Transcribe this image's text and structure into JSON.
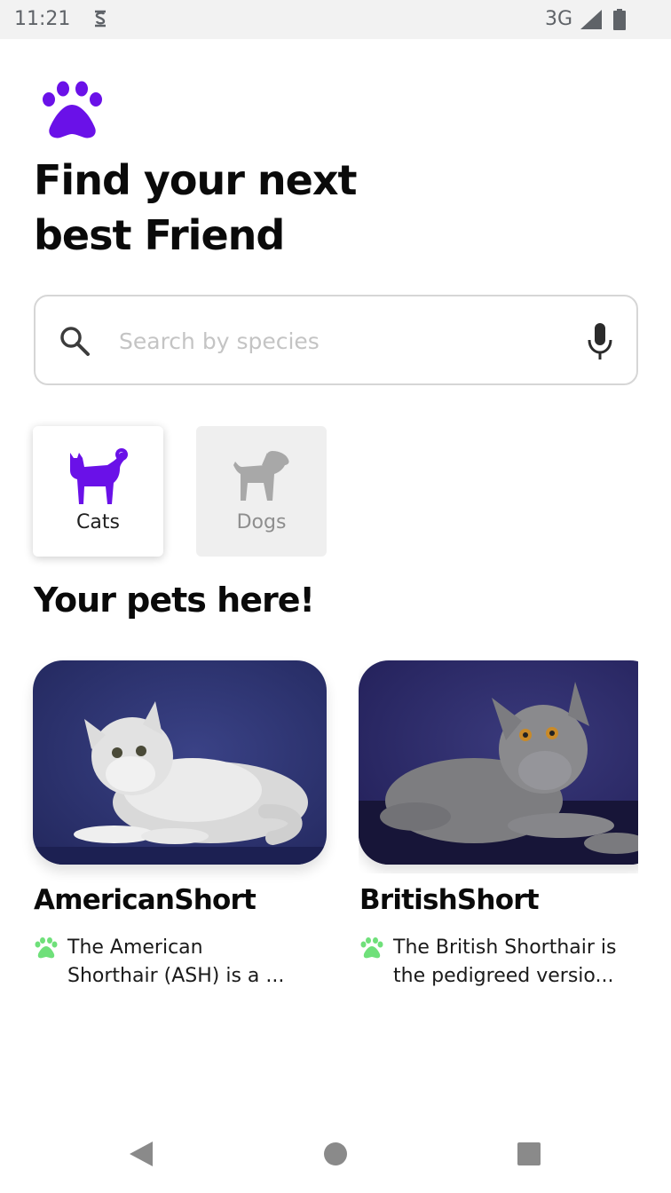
{
  "status_bar": {
    "time": "11:21",
    "network": "3G"
  },
  "header": {
    "logo_icon": "paw-icon",
    "title_line1": "Find your next",
    "title_line2": "best Friend"
  },
  "search": {
    "placeholder": "Search by species",
    "value": ""
  },
  "categories": [
    {
      "label": "Cats",
      "icon": "cat-icon",
      "selected": true
    },
    {
      "label": "Dogs",
      "icon": "dog-icon",
      "selected": false
    }
  ],
  "pets_section": {
    "title": "Your pets here!"
  },
  "pets": [
    {
      "name": "AmericanShort",
      "desc_line1": "The American",
      "desc_line2": "Shorthair (ASH) is a ..."
    },
    {
      "name": "BritishShort",
      "desc_line1": "The British Shorthair is",
      "desc_line2": "the pedigreed versio..."
    }
  ],
  "colors": {
    "accent": "#6a11e8",
    "paw_green": "#6fe07a",
    "inactive_icon": "#a8a8a8",
    "photo_background": "#2a2f6e"
  }
}
